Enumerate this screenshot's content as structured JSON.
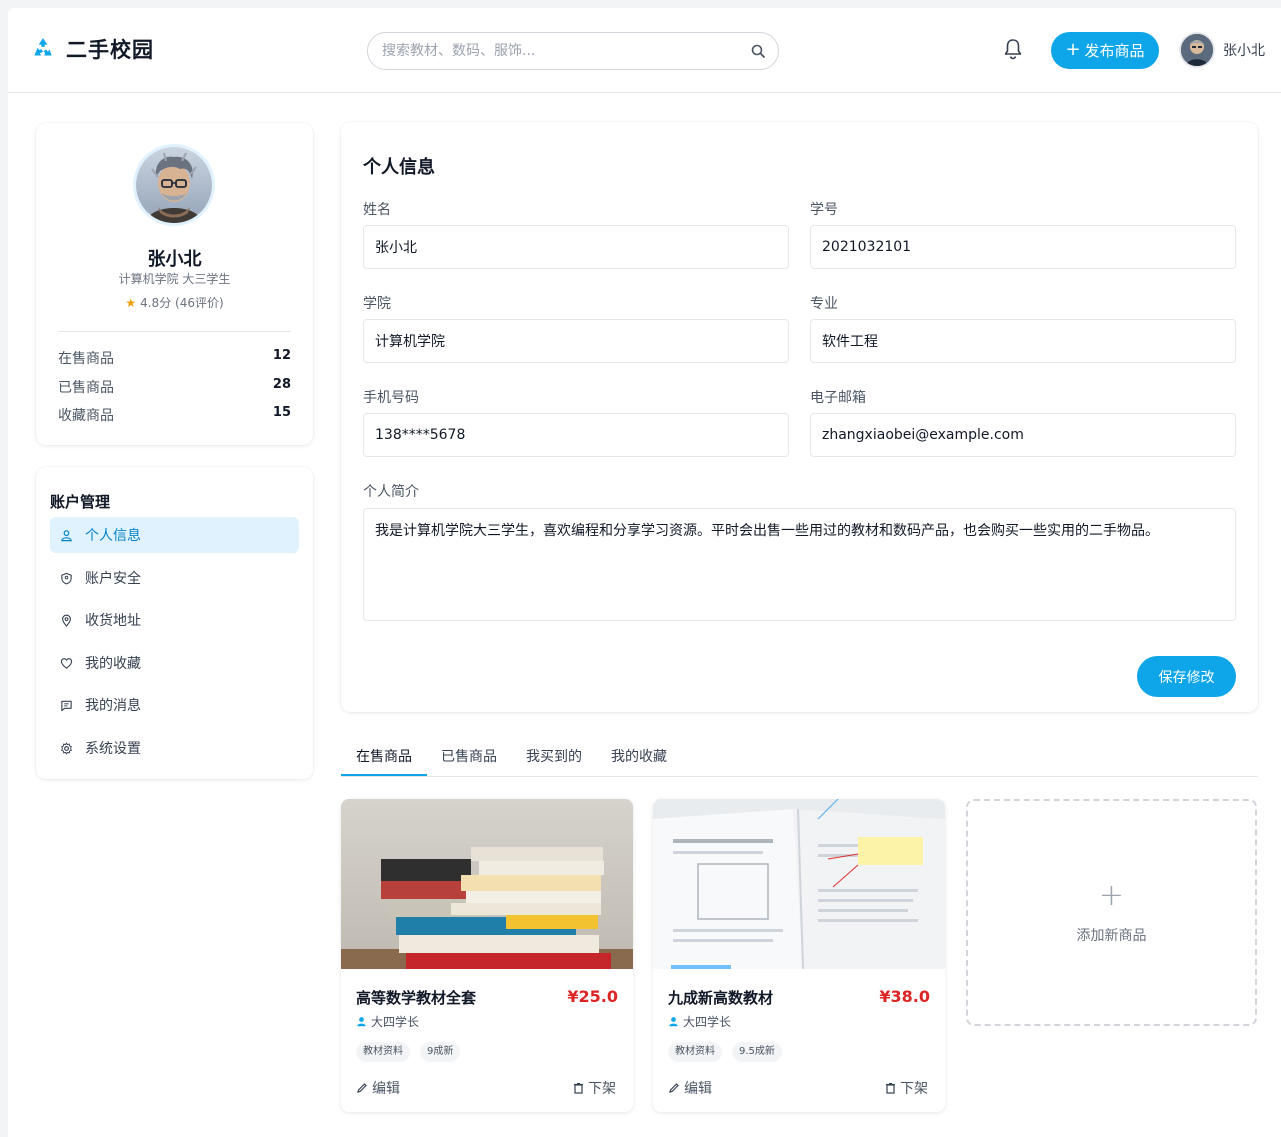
{
  "header": {
    "brand": "二手校园",
    "search_placeholder": "搜索教材、数码、服饰...",
    "publish_label": "发布商品",
    "user_name": "张小北"
  },
  "profile": {
    "name": "张小北",
    "dept": "计算机学院 大三学生",
    "rating": "4.8分 (46评价)",
    "stats": [
      {
        "label": "在售商品",
        "value": "12"
      },
      {
        "label": "已售商品",
        "value": "28"
      },
      {
        "label": "收藏商品",
        "value": "15"
      }
    ]
  },
  "menu": {
    "title": "账户管理",
    "items": [
      {
        "label": "个人信息",
        "icon": "user-icon",
        "active": true
      },
      {
        "label": "账户安全",
        "icon": "shield-icon",
        "active": false
      },
      {
        "label": "收货地址",
        "icon": "location-pin-icon",
        "active": false
      },
      {
        "label": "我的收藏",
        "icon": "heart-icon",
        "active": false
      },
      {
        "label": "我的消息",
        "icon": "message-icon",
        "active": false
      },
      {
        "label": "系统设置",
        "icon": "gear-icon",
        "active": false
      }
    ]
  },
  "info": {
    "title": "个人信息",
    "name_label": "姓名",
    "name_value": "张小北",
    "id_label": "学号",
    "id_value": "2021032101",
    "college_label": "学院",
    "college_value": "计算机学院",
    "major_label": "专业",
    "major_value": "软件工程",
    "phone_label": "手机号码",
    "phone_value": "138****5678",
    "email_label": "电子邮箱",
    "email_value": "zhangxiaobei@example.com",
    "bio_label": "个人简介",
    "bio_value": "我是计算机学院大三学生，喜欢编程和分享学习资源。平时会出售一些用过的教材和数码产品，也会购买一些实用的二手物品。",
    "save_label": "保存修改"
  },
  "tabs": [
    {
      "label": "在售商品",
      "active": true
    },
    {
      "label": "已售商品",
      "active": false
    },
    {
      "label": "我买到的",
      "active": false
    },
    {
      "label": "我的收藏",
      "active": false
    }
  ],
  "products": [
    {
      "title": "高等数学教材全套",
      "price": "¥25.0",
      "seller": "大四学长",
      "tags": [
        "教材资料",
        "9成新"
      ],
      "edit_label": "编辑",
      "remove_label": "下架"
    },
    {
      "title": "九成新高数教材",
      "price": "¥38.0",
      "seller": "大四学长",
      "tags": [
        "教材资料",
        "9.5成新"
      ],
      "edit_label": "编辑",
      "remove_label": "下架"
    }
  ],
  "add_product_label": "添加新商品",
  "colors": {
    "accent": "#0ea5e9",
    "price": "#dc2626",
    "active_bg": "#e0f2fe"
  }
}
